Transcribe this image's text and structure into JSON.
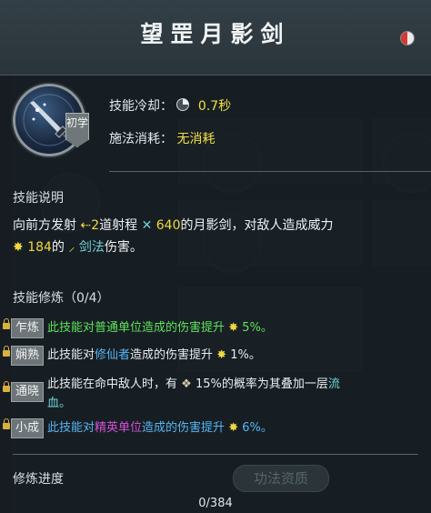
{
  "title": "望罡月影剑",
  "rank": "初学",
  "stats": {
    "cooldown_label": "技能冷却：",
    "cooldown_value": "0.7秒",
    "cost_label": "施法消耗：",
    "cost_value": "无消耗"
  },
  "description": {
    "heading": "技能说明",
    "line1_pre": "向前方发射",
    "line1_count": "2",
    "line1_mid": "道射程",
    "line1_range": "640",
    "line1_post": "的月影剑，对敌人造成威力",
    "line2_power": "184",
    "line2_mid": "的",
    "line2_type": "剑法",
    "line2_post": "伤害。"
  },
  "cultivation": {
    "heading": "技能修炼（0/4）",
    "rows": [
      {
        "stage": "乍炼",
        "pre": "此技能对",
        "hl": "普通单位",
        "post": "造成的伤害提升",
        "value": "5%。"
      },
      {
        "stage": "娴熟",
        "pre": "此技能对",
        "hl": "修仙者",
        "post": "造成的伤害提升",
        "value": "1%。"
      },
      {
        "stage": "通晓",
        "pre": "此技能在命中敌人时，有",
        "hl": "15%的概率为其叠加一层",
        "post": "流",
        "line2": "血。"
      },
      {
        "stage": "小成",
        "pre": "此技能对",
        "hl": "精英单位",
        "post": "造成的伤害提升",
        "value": "6%。"
      }
    ]
  },
  "progress": {
    "label": "修炼进度",
    "value": "0/384",
    "button": "功法资质"
  },
  "colors": {
    "highlight_yellow": "#f0d840",
    "green": "#5ee35a",
    "blue": "#56b6f4",
    "cyan": "#6fd3d6",
    "magenta": "#d44fd4"
  }
}
